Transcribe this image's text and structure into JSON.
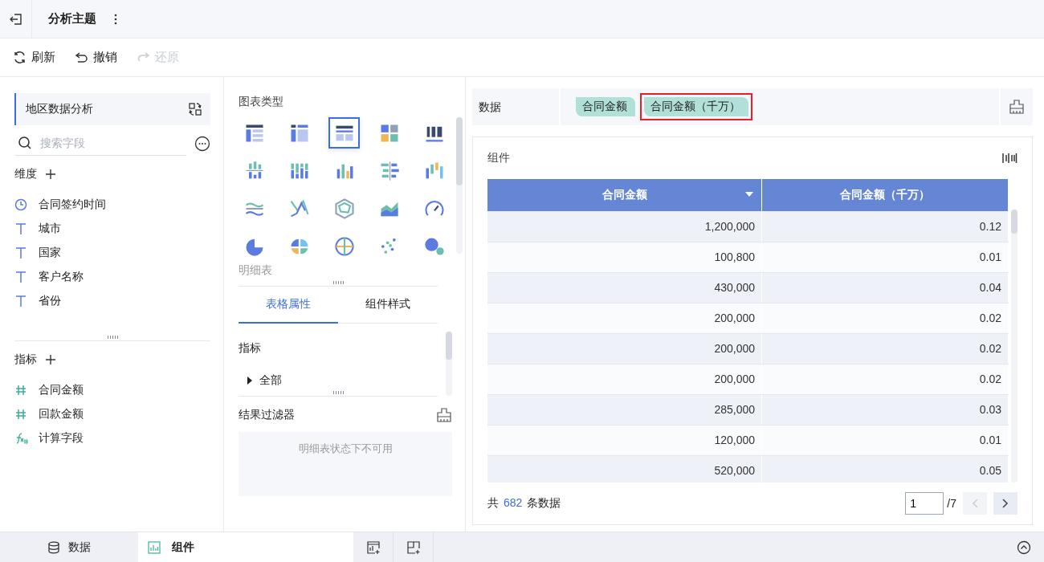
{
  "header": {
    "title": "分析主题"
  },
  "toolbar": [
    {
      "label": "刷新",
      "kind": "refresh",
      "disabled": false
    },
    {
      "label": "撤销",
      "kind": "undo",
      "disabled": false
    },
    {
      "label": "还原",
      "kind": "redo",
      "disabled": true
    }
  ],
  "dataset": {
    "name": "地区数据分析",
    "search_placeholder": "搜索字段"
  },
  "dimensions": {
    "title": "维度",
    "fields": [
      {
        "label": "合同签约时间",
        "kind": "time"
      },
      {
        "label": "城市",
        "kind": "text"
      },
      {
        "label": "国家",
        "kind": "text"
      },
      {
        "label": "客户名称",
        "kind": "text"
      },
      {
        "label": "省份",
        "kind": "text"
      }
    ]
  },
  "measures": {
    "title": "指标",
    "fields": [
      {
        "label": "合同金额",
        "kind": "number"
      },
      {
        "label": "回款金额",
        "kind": "number"
      },
      {
        "label": "计算字段",
        "kind": "calc"
      }
    ]
  },
  "chart_types": {
    "title": "图表类型",
    "caption": "明细表",
    "items": [
      {
        "selected": false
      },
      {
        "selected": false
      },
      {
        "selected": true
      },
      {
        "selected": false
      },
      {
        "selected": false
      },
      {
        "selected": false
      },
      {
        "selected": false
      },
      {
        "selected": false
      },
      {
        "selected": false
      },
      {
        "selected": false
      },
      {
        "selected": false
      },
      {
        "selected": false
      },
      {
        "selected": false
      },
      {
        "selected": false
      },
      {
        "selected": false
      },
      {
        "selected": false
      },
      {
        "selected": false
      },
      {
        "selected": false
      },
      {
        "selected": false
      },
      {
        "selected": false
      }
    ]
  },
  "property_tabs": [
    {
      "label": "表格属性",
      "selected": true
    },
    {
      "label": "组件样式",
      "selected": false
    }
  ],
  "properties": {
    "section": "指标",
    "group": {
      "label": "全部",
      "expanded": false
    }
  },
  "result_filter": {
    "title": "结果过滤器",
    "message": "明细表状态下不可用"
  },
  "data_bar": {
    "label": "数据",
    "chips": [
      {
        "label": "合同金额",
        "highlighted": false
      },
      {
        "label": "合同金额（千万）",
        "highlighted": true
      }
    ]
  },
  "component": {
    "title": "组件",
    "table": {
      "columns": [
        {
          "label": "合同金额",
          "sortable": true
        },
        {
          "label": "合同金额（千万）",
          "sortable": false
        }
      ],
      "rows": [
        [
          "1,200,000",
          "0.12"
        ],
        [
          "100,800",
          "0.01"
        ],
        [
          "430,000",
          "0.04"
        ],
        [
          "200,000",
          "0.02"
        ],
        [
          "200,000",
          "0.02"
        ],
        [
          "200,000",
          "0.02"
        ],
        [
          "285,000",
          "0.03"
        ],
        [
          "120,000",
          "0.01"
        ],
        [
          "520,000",
          "0.05"
        ]
      ]
    },
    "footer": {
      "prefix": "共",
      "count": "682",
      "suffix": "条数据",
      "page": "1",
      "pages": "/7"
    }
  },
  "bottom_tabs": [
    {
      "label": "数据",
      "kind": "database",
      "selected": false
    },
    {
      "label": "组件",
      "kind": "chart",
      "selected": true
    }
  ]
}
